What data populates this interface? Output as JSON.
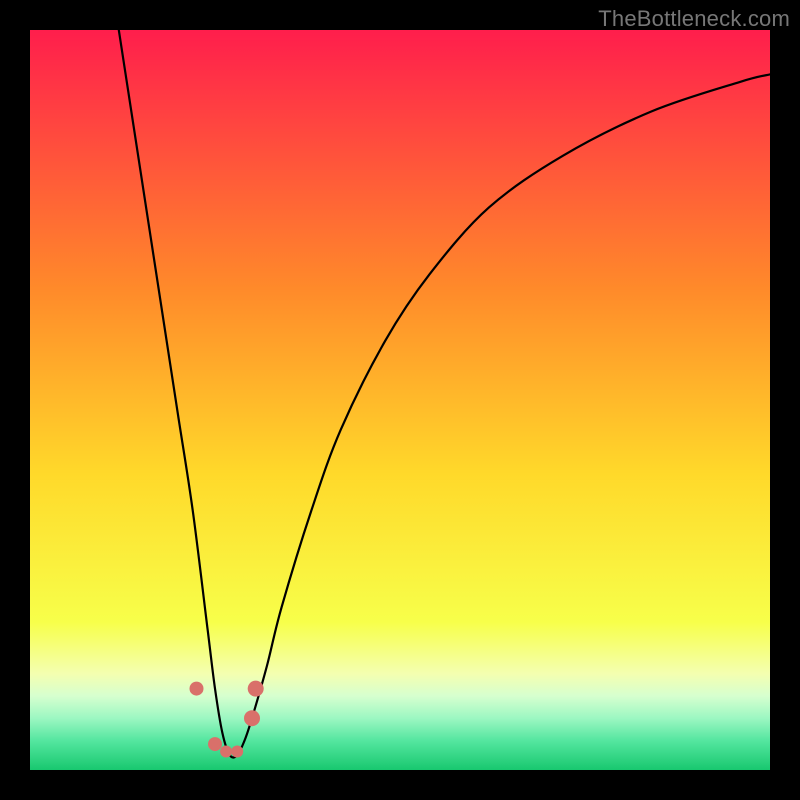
{
  "watermark": "TheBottleneck.com",
  "chart_data": {
    "type": "line",
    "title": "",
    "xlabel": "",
    "ylabel": "",
    "xlim": [
      0,
      100
    ],
    "ylim": [
      0,
      100
    ],
    "grid": false,
    "legend": false,
    "curve": {
      "description": "V-shaped bottleneck curve, minimum near x≈27",
      "x": [
        12,
        14,
        16,
        18,
        20,
        22,
        24,
        25,
        26,
        27,
        28,
        29,
        30,
        32,
        34,
        38,
        42,
        48,
        54,
        62,
        72,
        84,
        96,
        100
      ],
      "y": [
        100,
        87,
        74,
        61,
        48,
        35,
        19,
        11,
        5,
        2,
        2,
        4,
        7,
        14,
        22,
        35,
        46,
        58,
        67,
        76,
        83,
        89,
        93,
        94
      ]
    },
    "gradient_stops": [
      {
        "offset": 0.0,
        "color": "#ff1e4c"
      },
      {
        "offset": 0.35,
        "color": "#ff8a2a"
      },
      {
        "offset": 0.6,
        "color": "#ffd92a"
      },
      {
        "offset": 0.8,
        "color": "#f7ff4a"
      },
      {
        "offset": 0.87,
        "color": "#f4ffb0"
      },
      {
        "offset": 0.9,
        "color": "#d6ffcf"
      },
      {
        "offset": 0.93,
        "color": "#9cf7c2"
      },
      {
        "offset": 0.96,
        "color": "#55e6a0"
      },
      {
        "offset": 1.0,
        "color": "#18c86f"
      }
    ],
    "markers": [
      {
        "x": 22.5,
        "y": 11,
        "r": 7
      },
      {
        "x": 25.0,
        "y": 3.5,
        "r": 7
      },
      {
        "x": 26.5,
        "y": 2.5,
        "r": 6
      },
      {
        "x": 28.0,
        "y": 2.5,
        "r": 6
      },
      {
        "x": 30.0,
        "y": 7.0,
        "r": 8
      },
      {
        "x": 30.5,
        "y": 11.0,
        "r": 8
      }
    ],
    "marker_color": "#d9706a"
  }
}
